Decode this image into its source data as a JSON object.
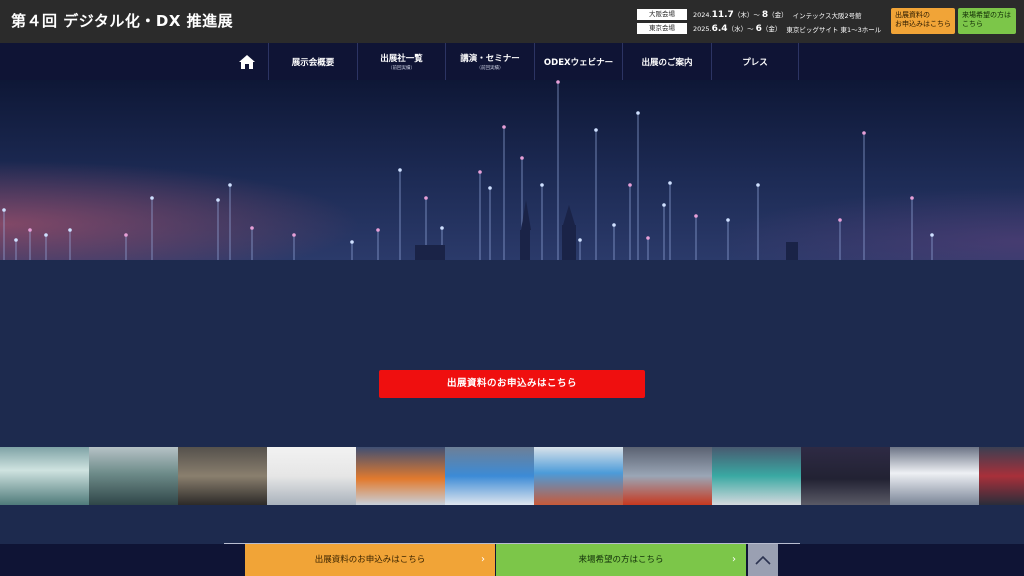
{
  "header": {
    "title": "第４回 デジタル化・DX 推進展",
    "venues": [
      {
        "tag": "大阪会場",
        "year": "2024.",
        "start": "11.7",
        "start_dow": "（木）",
        "sep": "～",
        "end": "8",
        "end_dow": "（金）",
        "place": "インテックス大阪2号館"
      },
      {
        "tag": "東京会場",
        "year": "2025.",
        "start": "6.4",
        "start_dow": "（水）",
        "sep": "～",
        "end": "6",
        "end_dow": "（金）",
        "place": "東京ビッグサイト 東1～3ホール"
      }
    ],
    "cta_exhibit": "出展資料の\nお申込みはこちら",
    "cta_visit": "来場希望の方は\nこちら"
  },
  "nav": {
    "items": [
      {
        "label": "展示会概要",
        "sub": ""
      },
      {
        "label": "出展社一覧",
        "sub": "（前回実績）"
      },
      {
        "label": "講演・セミナー",
        "sub": "（前回実績）"
      },
      {
        "label": "ODEXウェビナー",
        "sub": ""
      },
      {
        "label": "出展のご案内",
        "sub": ""
      },
      {
        "label": "プレス",
        "sub": ""
      }
    ]
  },
  "main": {
    "cta_label": "出展資料のお申込みはこちら"
  },
  "bottom": {
    "exhibit_label": "出展資料のお申込みはこちら",
    "visit_label": "来場希望の方はこちら",
    "chevron": "›"
  },
  "colors": {
    "header_bg": "#2b2b2b",
    "nav_bg": "#0f1435",
    "page_bg": "#1d2a4e",
    "cta_red": "#ef0f0f",
    "cta_orange": "#f1a437",
    "cta_green": "#7cc649"
  },
  "icons": {
    "home": "home-icon",
    "back_to_top": "chevron-up-icon"
  }
}
